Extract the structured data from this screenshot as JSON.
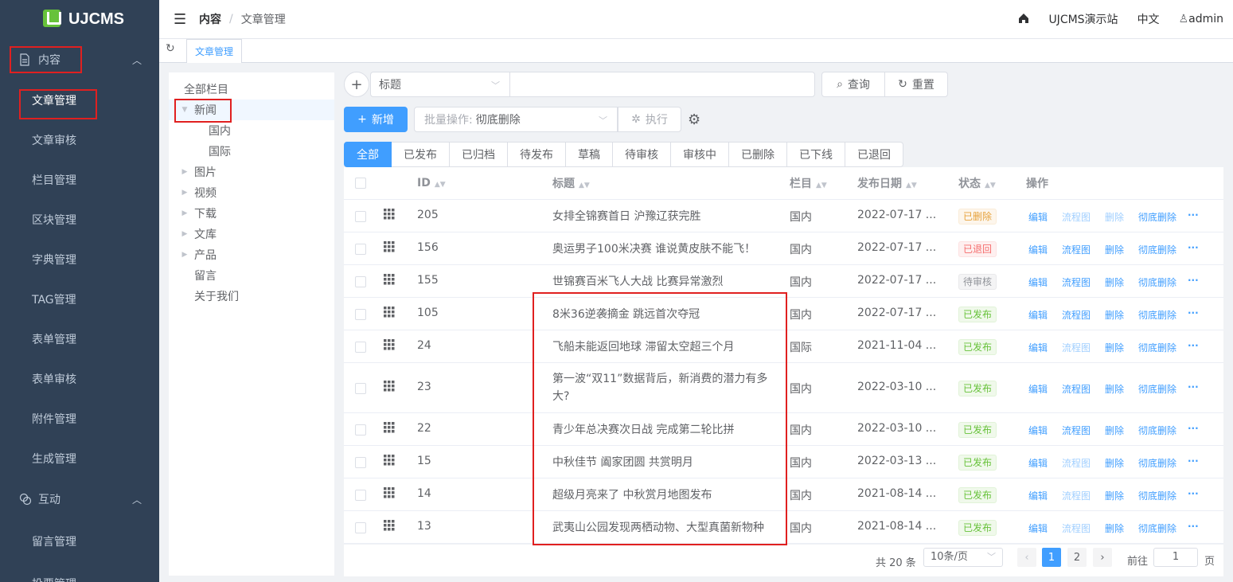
{
  "app": {
    "logo": "UJCMS"
  },
  "sidebar": {
    "groups": [
      {
        "label": "内容",
        "icon": "document-icon"
      },
      {
        "label": "互动",
        "icon": "chat-icon"
      }
    ],
    "content_items": [
      "文章管理",
      "文章审核",
      "栏目管理",
      "区块管理",
      "字典管理",
      "TAG管理",
      "表单管理",
      "表单审核",
      "附件管理",
      "生成管理"
    ],
    "interact_items": [
      "留言管理",
      "投票管理"
    ]
  },
  "header": {
    "breadcrumb": {
      "root": "内容",
      "current": "文章管理"
    },
    "site": "UJCMS演示站",
    "lang": "中文",
    "user": "admin"
  },
  "tags": {
    "current": "文章管理"
  },
  "tree": {
    "root": "全部栏目",
    "nodes": [
      {
        "label": "新闻",
        "level": 1,
        "expand": "open"
      },
      {
        "label": "国内",
        "level": 2,
        "expand": ""
      },
      {
        "label": "国际",
        "level": 2,
        "expand": ""
      },
      {
        "label": "图片",
        "level": 1,
        "expand": "closed"
      },
      {
        "label": "视频",
        "level": 1,
        "expand": "closed"
      },
      {
        "label": "下载",
        "level": 1,
        "expand": "closed"
      },
      {
        "label": "文库",
        "level": 1,
        "expand": "closed"
      },
      {
        "label": "产品",
        "level": 1,
        "expand": "closed"
      },
      {
        "label": "留言",
        "level": 1,
        "expand": ""
      },
      {
        "label": "关于我们",
        "level": 1,
        "expand": ""
      }
    ]
  },
  "search": {
    "field": "标题",
    "query_label": "查询",
    "reset_label": "重置"
  },
  "toolbar": {
    "add_label": "新增",
    "batch_prefix": "批量操作:",
    "batch_value": "彻底删除",
    "exec_label": "执行"
  },
  "status_tabs": [
    "全部",
    "已发布",
    "已归档",
    "待发布",
    "草稿",
    "待审核",
    "审核中",
    "已删除",
    "已下线",
    "已退回"
  ],
  "table": {
    "columns": {
      "id": "ID",
      "title": "标题",
      "channel": "栏目",
      "date": "发布日期",
      "status": "状态",
      "ops": "操作"
    },
    "actions": {
      "edit": "编辑",
      "flow": "流程图",
      "delete": "删除",
      "purge": "彻底删除",
      "more": "···"
    },
    "rows": [
      {
        "id": "205",
        "title": "女排全锦赛首日 沪豫辽获完胜",
        "channel": "国内",
        "date": "2022-07-17 ...",
        "status": "已删除",
        "status_type": "del",
        "flow_disabled": true,
        "delete_disabled": true,
        "tall": false
      },
      {
        "id": "156",
        "title": "奥运男子100米决赛 谁说黄皮肤不能飞！",
        "channel": "国内",
        "date": "2022-07-17 ...",
        "status": "已退回",
        "status_type": "ret",
        "flow_disabled": false,
        "delete_disabled": false,
        "tall": false
      },
      {
        "id": "155",
        "title": "世锦赛百米飞人大战 比赛异常激烈",
        "channel": "国内",
        "date": "2022-07-17 ...",
        "status": "待审核",
        "status_type": "pend",
        "flow_disabled": false,
        "delete_disabled": false,
        "tall": false
      },
      {
        "id": "105",
        "title": "8米36逆袭摘金 跳远首次夺冠",
        "channel": "国内",
        "date": "2022-07-17 ...",
        "status": "已发布",
        "status_type": "pub",
        "flow_disabled": false,
        "delete_disabled": false,
        "tall": false
      },
      {
        "id": "24",
        "title": "飞船未能返回地球 滞留太空超三个月",
        "channel": "国际",
        "date": "2021-11-04 ...",
        "status": "已发布",
        "status_type": "pub",
        "flow_disabled": true,
        "delete_disabled": false,
        "tall": false
      },
      {
        "id": "23",
        "title": "第一波“双11”数据背后，新消费的潜力有多大?",
        "channel": "国内",
        "date": "2022-03-10 ...",
        "status": "已发布",
        "status_type": "pub",
        "flow_disabled": false,
        "delete_disabled": false,
        "tall": true
      },
      {
        "id": "22",
        "title": "青少年总决赛次日战 完成第二轮比拼",
        "channel": "国内",
        "date": "2022-03-10 ...",
        "status": "已发布",
        "status_type": "pub",
        "flow_disabled": false,
        "delete_disabled": false,
        "tall": false
      },
      {
        "id": "15",
        "title": "中秋佳节 阖家团圆 共赏明月",
        "channel": "国内",
        "date": "2022-03-13 ...",
        "status": "已发布",
        "status_type": "pub",
        "flow_disabled": true,
        "delete_disabled": false,
        "tall": false
      },
      {
        "id": "14",
        "title": "超级月亮来了 中秋赏月地图发布",
        "channel": "国内",
        "date": "2021-08-14 ...",
        "status": "已发布",
        "status_type": "pub",
        "flow_disabled": true,
        "delete_disabled": false,
        "tall": false
      },
      {
        "id": "13",
        "title": "武夷山公园发现两栖动物、大型真菌新物种",
        "channel": "国内",
        "date": "2021-08-14 ...",
        "status": "已发布",
        "status_type": "pub",
        "flow_disabled": true,
        "delete_disabled": false,
        "tall": false
      }
    ]
  },
  "pagination": {
    "total": "共 20 条",
    "page_size": "10条/页",
    "pages": [
      "1",
      "2"
    ],
    "current": "1",
    "goto_label": "前往",
    "goto_value": "1",
    "page_label": "页"
  }
}
